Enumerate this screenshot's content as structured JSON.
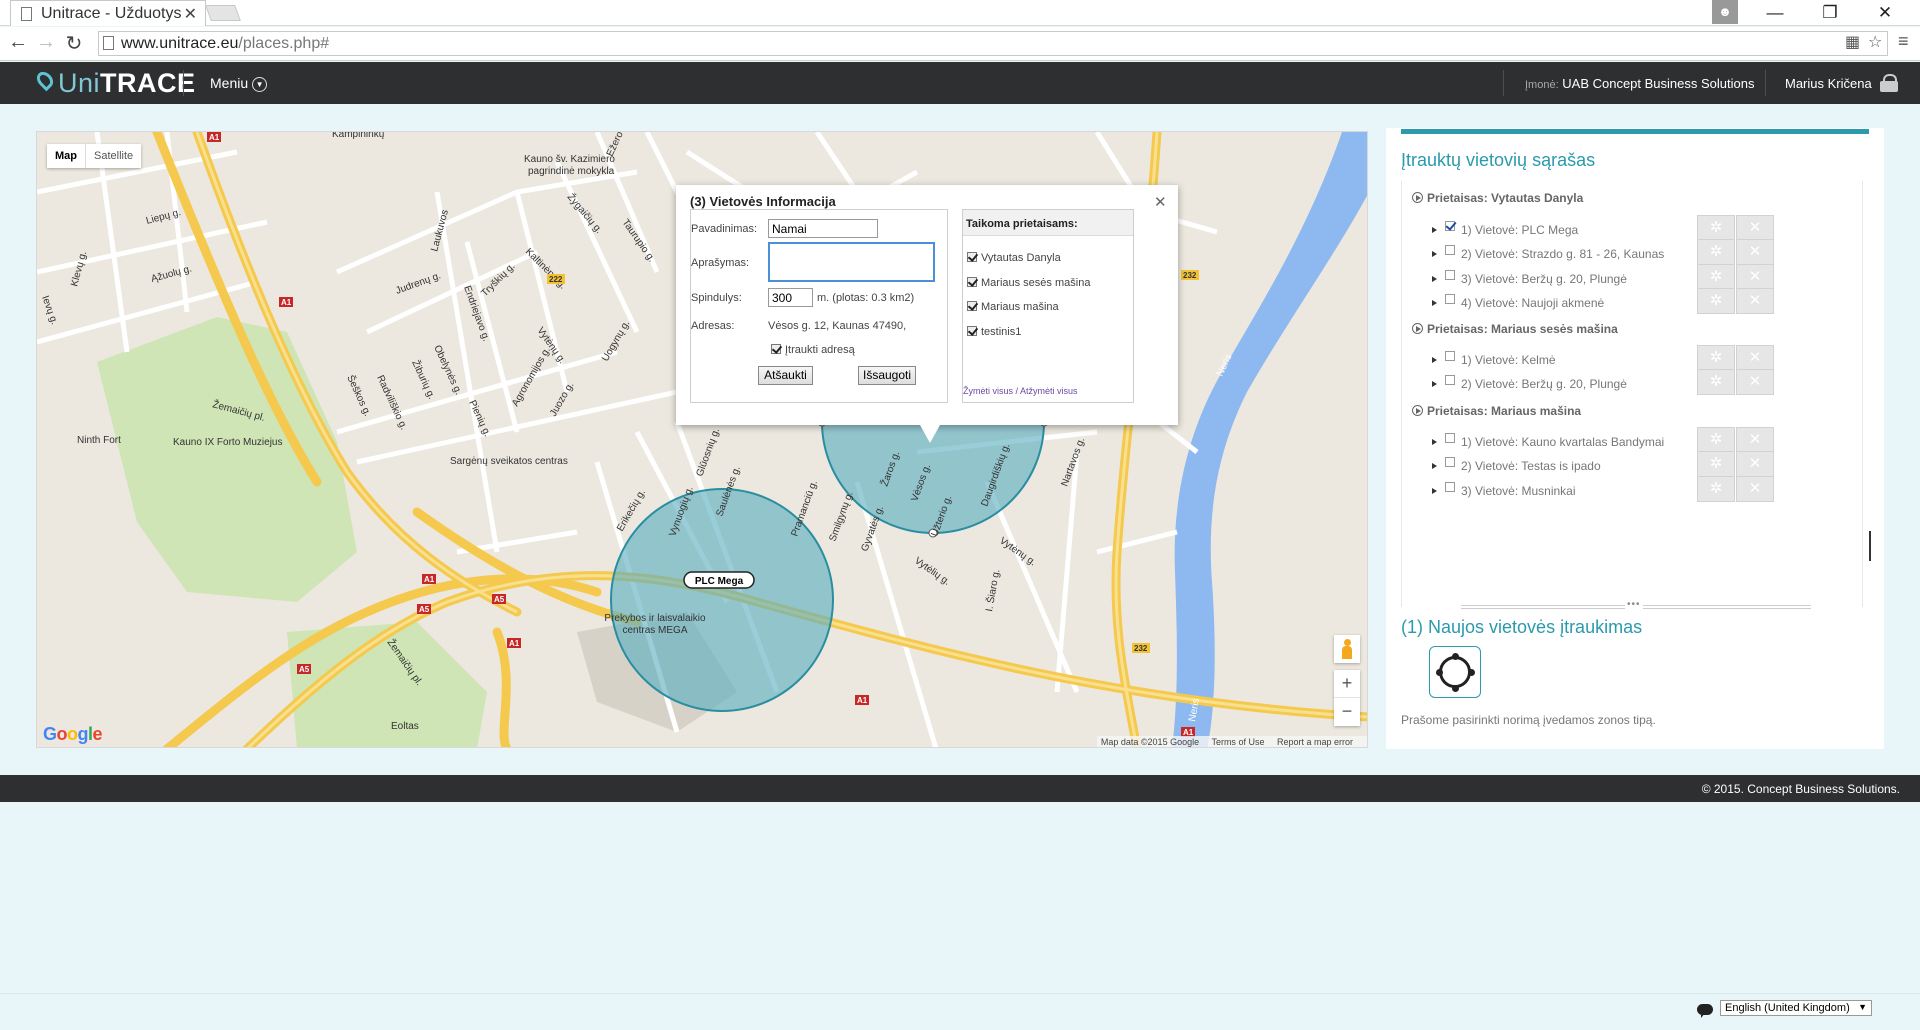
{
  "browser": {
    "tab_title": "Unitrace - Užduotys",
    "tab_close": "✕",
    "url_host": "www.unitrace.eu",
    "url_path": "/places.php#"
  },
  "header": {
    "logo_uni": "Uni",
    "logo_trace": "TRACE",
    "menu_label": "Meniu",
    "company_label": "Įmonė:",
    "company_name": "UAB Concept Business Solutions",
    "user_name": "Marius Kričena"
  },
  "map": {
    "type_map": "Map",
    "type_satellite": "Satellite",
    "zoom_in": "+",
    "zoom_out": "−",
    "attribution_data": "Map data ©2015 Google",
    "attribution_terms": "Terms of Use",
    "attribution_report": "Report a map error",
    "labels": {
      "kauno_mokykla": "Kauno šv. Kazimiero",
      "kauno_mokykla2": "pagrindinė mokykla",
      "ninth_fort": "Ninth Fort",
      "muziejus": "Kauno IX Forto Muziejus",
      "sargenu": "Sargėnų sveikatos centras",
      "plc_mega": "PLC Mega",
      "mega1": "Prekybos ir laisvalaikio",
      "mega2": "centras MEGA",
      "eoltas": "Eoltas",
      "neris1": "Neris",
      "neris2": "Neris",
      "s_a1_1": "A1",
      "s_a1_2": "A1",
      "s_a1_3": "A1",
      "s_a1_4": "A1",
      "s_a5_1": "A5",
      "s_a5_2": "A5",
      "s_a5_3": "A5",
      "s_222": "222",
      "s_232_1": "232",
      "s_232_2": "232",
      "liepu": "Liepų g.",
      "azuolu": "Ąžuolų g.",
      "klevu": "Klevų g.",
      "ievu": "Ievų g.",
      "zemaiciu1": "Žemaičių pl.",
      "zemaiciu2": "Žemaičių pl.",
      "judrenu": "Judrenų g.",
      "laukuvos": "Laukuvos",
      "endriejavo": "Endriejavo g.",
      "trysku": "Tryškių g.",
      "kaltinenu": "Kaltinėnų g.",
      "zygaiciu": "Žygaičių g.",
      "taurupio": "Taurupio g.",
      "ezero": "Ežero g.",
      "vytenu1": "Vytėnų g.",
      "uogynu": "Uogynų g.",
      "obelynes": "Obelynės g.",
      "ziburiu": "Žiburių g.",
      "radviliskio": "Radviliškio g.",
      "seskos": "Šeškos g.",
      "pieniu": "Pienių g.",
      "agronomijos": "Agronomijos g.",
      "juozo": "Juozo g.",
      "erikeciu": "Erikečių g.",
      "vynuogiu": "Vynuogių g.",
      "saulenes": "Saulėnės g.",
      "glucosiniu": "Glūosnių g.",
      "pramanciu": "Pramanciū g.",
      "smilgynu": "Smilgynų g.",
      "gyvates": "Gyvatės g.",
      "zaros": "Žaros g.",
      "vesos": "Vėsos g.",
      "uzterio": "Užterio g.",
      "daugirdisku": "Daugirdiškių g.",
      "vytenu2": "Vytėnų g.",
      "vytelu": "Vytėlių g.",
      "narbutas": "Nartavos g.",
      "starto": "I. Šiaro g.",
      "kampas": "Kampininkų"
    }
  },
  "infowindow": {
    "title": "(3) Vietovės Informacija",
    "close": "✕",
    "name_label": "Pavadinimas:",
    "name_value": "Namai",
    "desc_label": "Aprašymas:",
    "desc_value": "",
    "radius_label": "Spindulys:",
    "radius_value": "300",
    "radius_unit": "m. (plotas: 0.3 km2)",
    "address_label": "Adresas:",
    "address_value": "Vėsos g. 12, Kaunas 47490,",
    "include_address": "Įtraukti adresą",
    "include_address_checked": true,
    "cancel": "Atšaukti",
    "save": "Išsaugoti",
    "devices_title": "Taikoma prietaisams:",
    "devices": [
      {
        "name": "Vytautas Danyla",
        "checked": true
      },
      {
        "name": "Mariaus sesės mašina",
        "checked": true
      },
      {
        "name": "Mariaus mašina",
        "checked": true
      },
      {
        "name": "testinis1",
        "checked": true
      }
    ],
    "select_all": "Žymėti visus / Atžymėti visus"
  },
  "rpanel": {
    "title": "Įtrauktų vietovių sąrašas",
    "groups": [
      {
        "name": "Prietaisas: Vytautas Danyla",
        "items": [
          {
            "label": "1) Vietovė: PLC Mega",
            "checked": true
          },
          {
            "label": "2) Vietovė: Strazdo g. 81 - 26, Kaunas",
            "checked": false
          },
          {
            "label": "3) Vietovė: Beržų g. 20, Plungė",
            "checked": false
          },
          {
            "label": "4) Vietovė: Naujoji akmenė",
            "checked": false
          }
        ]
      },
      {
        "name": "Prietaisas: Mariaus sesės mašina",
        "items": [
          {
            "label": "1) Vietovė: Kelmė",
            "checked": false
          },
          {
            "label": "2) Vietovė: Beržų g. 20, Plungė",
            "checked": false
          }
        ]
      },
      {
        "name": "Prietaisas: Mariaus mašina",
        "items": [
          {
            "label": "1) Vietovė: Kauno kvartalas Bandymai",
            "checked": false
          },
          {
            "label": "2) Vietovė: Testas is ipado",
            "checked": false
          },
          {
            "label": "3) Vietovė: Musninkai",
            "checked": false
          }
        ]
      }
    ],
    "new_title": "(1) Naujos vietovės įtraukimas",
    "hint": "Prašome pasirinkti norimą įvedamos zonos tipą."
  },
  "footer": {
    "copyright": "© 2015. Concept Business Solutions."
  },
  "language": {
    "selected": "English (United Kingdom)"
  },
  "colors": {
    "accent": "#2a9aac",
    "header_bg": "#2d2f31",
    "page_bg": "#e8f6f9",
    "circle_fill": "#5bafc0",
    "highway": "#f9d45a"
  }
}
